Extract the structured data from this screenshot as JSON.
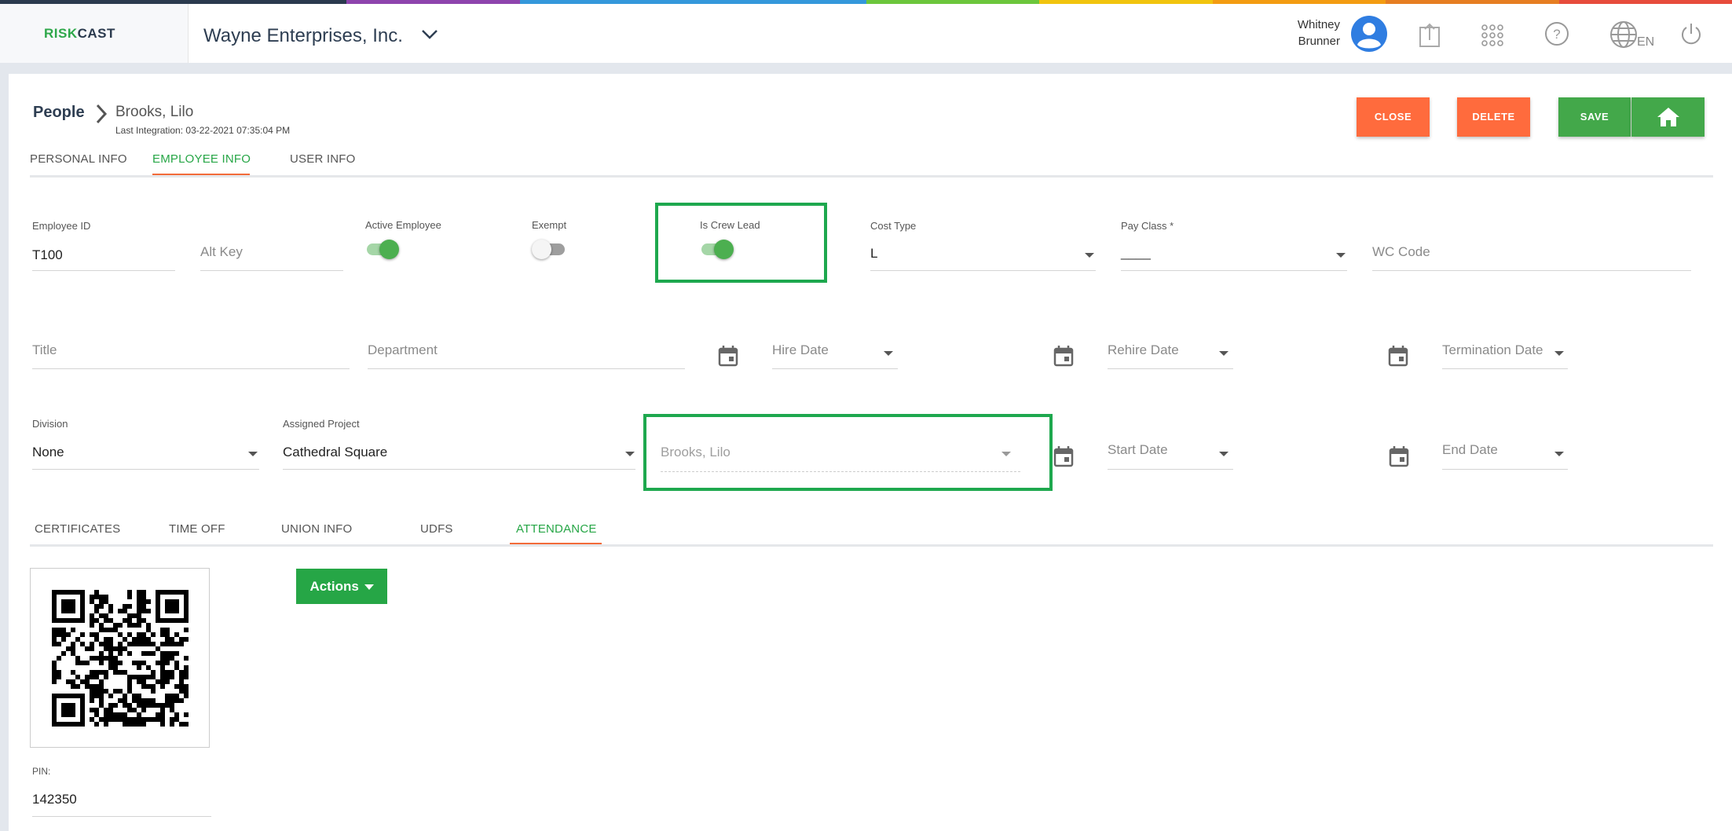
{
  "brand": {
    "logo_part1": "RISK",
    "logo_part2": "CAST",
    "logo_color1": "#2ea84a",
    "logo_color2": "#2b3a4e",
    "rainbow": [
      "#2b3a4e",
      "#2b3a4e",
      "#8e44ad",
      "#3498db",
      "#3498db",
      "#6cc63c",
      "#f1c40f",
      "#f39c12",
      "#e67e22",
      "#e74c3c"
    ]
  },
  "header": {
    "company": "Wayne Enterprises, Inc.",
    "user_first": "Whitney",
    "user_last": "Brunner",
    "language": "EN",
    "icons": [
      "avatar-icon",
      "upload-icon",
      "apps-grid-icon",
      "help-icon",
      "globe-icon",
      "power-icon"
    ]
  },
  "breadcrumb": {
    "root": "People",
    "current": "Brooks, Lilo",
    "last_integration": "Last Integration: 03-22-2021 07:35:04 PM"
  },
  "actions": {
    "close": "CLOSE",
    "delete": "DELETE",
    "save": "SAVE",
    "close_color": "#ff6b3d",
    "save_color": "#43a84a"
  },
  "main_tabs": [
    {
      "label": "PERSONAL INFO",
      "active": false
    },
    {
      "label": "EMPLOYEE INFO",
      "active": true
    },
    {
      "label": "USER INFO",
      "active": false
    }
  ],
  "form": {
    "employee_id_label": "Employee ID",
    "employee_id_value": "T100",
    "alt_key_placeholder": "Alt Key",
    "active_employee_label": "Active Employee",
    "active_employee_on": true,
    "exempt_label": "Exempt",
    "exempt_on": false,
    "crew_lead_label": "Is Crew Lead",
    "crew_lead_on": true,
    "cost_type_label": "Cost Type",
    "cost_type_value": "L",
    "pay_class_label": "Pay Class *",
    "pay_class_value": "____",
    "wc_code_placeholder": "WC Code",
    "title_placeholder": "Title",
    "department_placeholder": "Department",
    "hire_date_placeholder": "Hire Date",
    "rehire_date_placeholder": "Rehire Date",
    "termination_date_placeholder": "Termination Date",
    "division_label": "Division",
    "division_value": "None",
    "assigned_project_label": "Assigned Project",
    "assigned_project_value": "Cathedral Square",
    "crew_lead_select_placeholder": "Brooks, Lilo",
    "start_date_placeholder": "Start Date",
    "end_date_placeholder": "End Date"
  },
  "sub_tabs": [
    {
      "label": "CERTIFICATES",
      "active": false
    },
    {
      "label": "TIME OFF",
      "active": false
    },
    {
      "label": "UNION INFO",
      "active": false
    },
    {
      "label": "UDFS",
      "active": false
    },
    {
      "label": "ATTENDANCE",
      "active": true
    }
  ],
  "attendance": {
    "actions_label": "Actions",
    "pin_label": "PIN:",
    "pin_value": "142350"
  },
  "colors": {
    "accent_green": "#26a646",
    "highlight_green": "#1ea84e",
    "tab_underline": "#f26b3a",
    "toggle_on": "#4caf50"
  }
}
